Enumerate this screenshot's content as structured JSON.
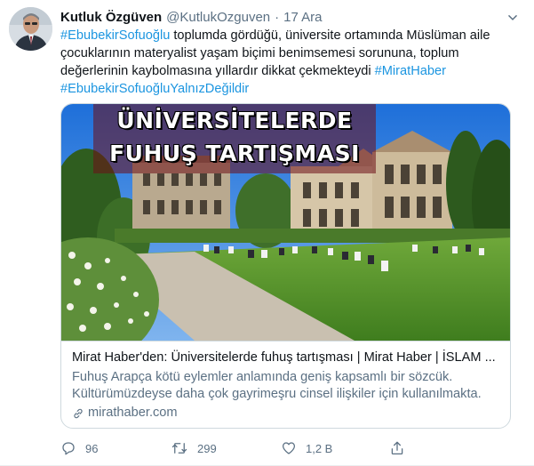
{
  "tweet": {
    "author": {
      "display_name": "Kutluk Özgüven",
      "handle": "@KutlukOzguven",
      "separator": "·",
      "date": "17 Ara"
    },
    "body": {
      "segments": [
        {
          "text": "#EbubekirSofuoğlu",
          "kind": "hashtag"
        },
        {
          "text": " toplumda gördüğü, üniversite ortamında Müslüman aile çocuklarının materyalist yaşam biçimi benimsemesi sorununa, toplum değerlerinin kaybolmasına yıllardır dikkat çekmekteydi ",
          "kind": "text"
        },
        {
          "text": "#MiratHaber",
          "kind": "hashtag"
        },
        {
          "text": " ",
          "kind": "text"
        },
        {
          "text": "#EbubekirSofuoğluYalnızDeğildir",
          "kind": "hashtag"
        }
      ]
    },
    "card": {
      "banner_line1": "ÜNİVERSİTELERDE",
      "banner_line2": "FUHUŞ TARTIŞMASI",
      "title": "Mirat Haber'den: Üniversitelerde fuhuş tartışması | Mirat Haber | İSLAM ...",
      "description": "Fuhuş Arapça kötü eylemler anlamında geniş kapsamlı bir sözcük. Kültürümüzdeyse daha çok gayrimeşru cinsel ilişkiler için kullanılmakta.",
      "domain": "mirathaber.com"
    },
    "actions": {
      "reply_count": "96",
      "retweet_count": "299",
      "like_count": "1,2 B"
    },
    "icons": {
      "more": "more-icon",
      "reply": "reply-icon",
      "retweet": "retweet-icon",
      "like": "heart-icon",
      "share": "share-icon",
      "link": "link-icon"
    },
    "colors": {
      "hashtag": "#1b95e0",
      "secondary_text": "#5b7083",
      "border": "#cfd9de"
    }
  }
}
